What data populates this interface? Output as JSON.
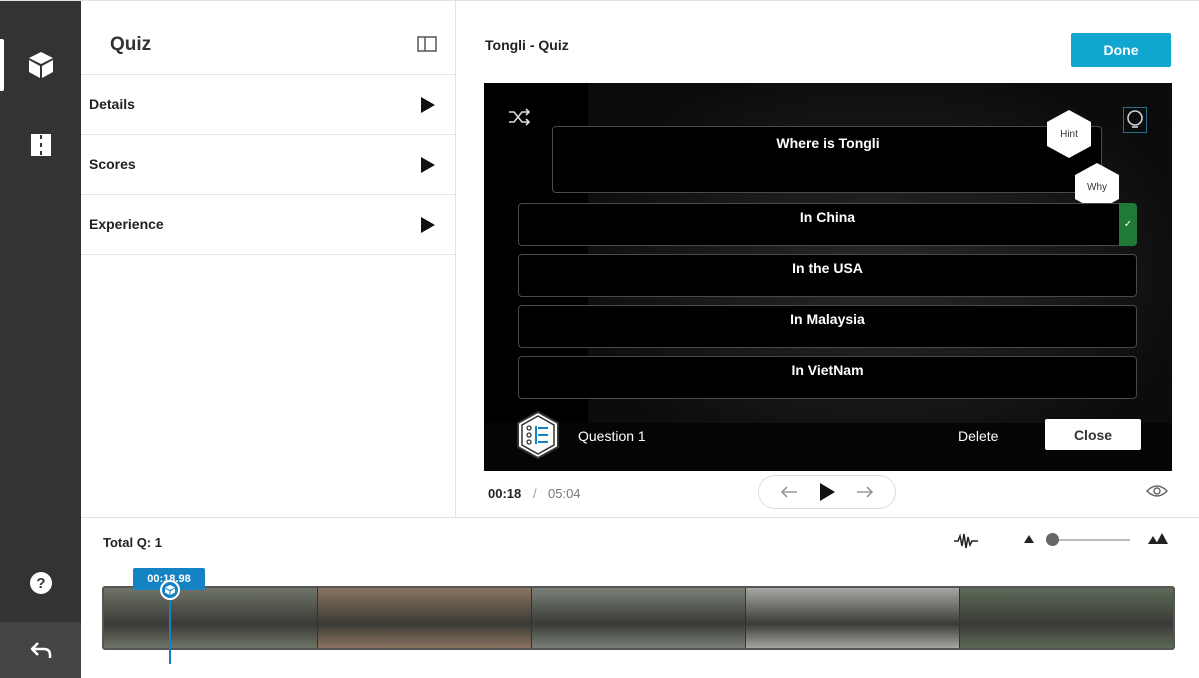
{
  "panel": {
    "title": "Quiz",
    "rows": [
      {
        "label": "Details"
      },
      {
        "label": "Scores"
      },
      {
        "label": "Experience"
      }
    ]
  },
  "header": {
    "title": "Tongli - Quiz",
    "done_label": "Done"
  },
  "quiz": {
    "question": "Where is Tongli",
    "hint_label": "Hint",
    "why_label": "Why",
    "answers": [
      {
        "text": "In China",
        "correct": true
      },
      {
        "text": "In the USA",
        "correct": false
      },
      {
        "text": "In Malaysia",
        "correct": false
      },
      {
        "text": "In VietNam",
        "correct": false
      }
    ],
    "question_label": "Question 1",
    "delete_label": "Delete",
    "close_label": "Close",
    "correct_mark": "✓"
  },
  "player": {
    "current_time": "00:18",
    "separator": "/",
    "total_time": "05:04"
  },
  "timeline": {
    "total_label": "Total Q: 1",
    "marker_time": "00:18.98",
    "zoom_level": 0.0,
    "frame_colors": [
      "#6f7468",
      "#8a7460",
      "#7a8078",
      "#a6a6a2",
      "#5c6a58"
    ]
  },
  "colors": {
    "accent": "#11a6cf",
    "marker": "#1582c4",
    "correct": "#1f7a35",
    "rail": "#333333"
  }
}
